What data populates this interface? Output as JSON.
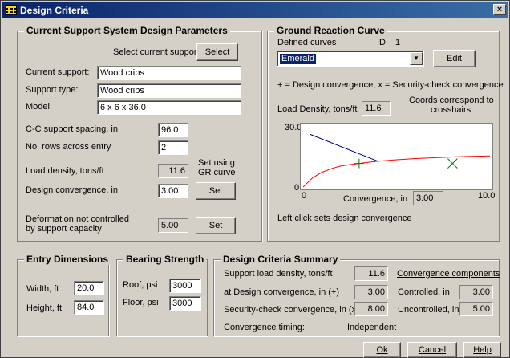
{
  "window": {
    "title": "Design Criteria",
    "close_label": "×"
  },
  "support_params": {
    "title": "Current Support System Design Parameters",
    "select_prompt": "Select current support",
    "select_button": "Select",
    "current_support_label": "Current support:",
    "current_support_value": "Wood cribs",
    "support_type_label": "Support type:",
    "support_type_value": "Wood cribs",
    "model_label": "Model:",
    "model_value": "6 x 6 x 36.0",
    "cc_spacing_label": "C-C support spacing, in",
    "cc_spacing_value": "96.0",
    "rows_label": "No. rows across entry",
    "rows_value": "2",
    "load_density_label": "Load density, tons/ft",
    "load_density_value": "11.6",
    "set_using_note_line1": "Set using",
    "set_using_note_line2": "GR curve",
    "design_conv_label": "Design convergence, in",
    "design_conv_value": "3.00",
    "set_button": "Set",
    "deformation_label_line1": "Deformation not controlled",
    "deformation_label_line2": "by support capacity",
    "deformation_value": "5.00",
    "set_button2": "Set"
  },
  "grc": {
    "title": "Ground Reaction Curve",
    "defined_curves_label": "Defined curves",
    "id_label": "ID",
    "id_value": "1",
    "curve_selected": "Emerald",
    "edit_button": "Edit",
    "legend_text": "+ = Design convergence, x = Security-check convergence",
    "load_density_label": "Load Density, tons/ft",
    "load_density_value": "11.6",
    "coords_note_line1": "Coords correspond to",
    "coords_note_line2": "crosshairs",
    "conv_label": "Convergence, in",
    "conv_value": "3.00",
    "click_note": "Left click sets design convergence"
  },
  "chart_data": {
    "type": "line",
    "xlabel": "Convergence, in",
    "ylabel": "",
    "xlim": [
      0,
      10.0
    ],
    "ylim": [
      0,
      30.0
    ],
    "x_tick_labels": [
      "0",
      "10.0"
    ],
    "y_tick_labels": [
      "0",
      "30.0"
    ],
    "series": [
      {
        "color": "#ff0000",
        "x": [
          0,
          0.5,
          1,
          1.5,
          2,
          2.5,
          3,
          3.5,
          4,
          5,
          6,
          7,
          8,
          9,
          10
        ],
        "values": [
          0,
          4.5,
          7.2,
          9.0,
          10.3,
          11.0,
          11.6,
          12.2,
          12.7,
          13.4,
          14.0,
          14.4,
          14.8,
          15.1,
          15.3
        ]
      },
      {
        "color": "#00008b",
        "x": [
          0.35,
          4.0
        ],
        "values": [
          26.0,
          12.7
        ]
      }
    ],
    "markers": [
      {
        "symbol": "+",
        "x": 3.0,
        "y": 11.6,
        "color": "#008000"
      },
      {
        "symbol": "x",
        "x": 8.0,
        "y": 11.6,
        "color": "#008000"
      }
    ]
  },
  "entry": {
    "title": "Entry Dimensions",
    "width_label": "Width, ft",
    "width_value": "20.0",
    "height_label": "Height, ft",
    "height_value": "84.0"
  },
  "bearing": {
    "title": "Bearing Strength",
    "roof_label": "Roof, psi",
    "roof_value": "3000",
    "floor_label": "Floor, psi",
    "floor_value": "3000"
  },
  "summary": {
    "title": "Design Criteria Summary",
    "support_load_label": "Support load density, tons/ft",
    "support_load_value": "11.6",
    "design_conv_label": "at Design convergence, in (+)",
    "design_conv_value": "3.00",
    "security_conv_label": "Security-check convergence, in (x)",
    "security_conv_value": "8.00",
    "timing_label": "Convergence timing:",
    "timing_value": "Independent",
    "components_label": "Convergence components",
    "controlled_label": "Controlled, in",
    "controlled_value": "3.00",
    "uncontrolled_label": "Uncontrolled, in",
    "uncontrolled_value": "5.00"
  },
  "footer": {
    "ok_label": "Ok",
    "cancel_label": "Cancel",
    "help_label": "Help"
  }
}
